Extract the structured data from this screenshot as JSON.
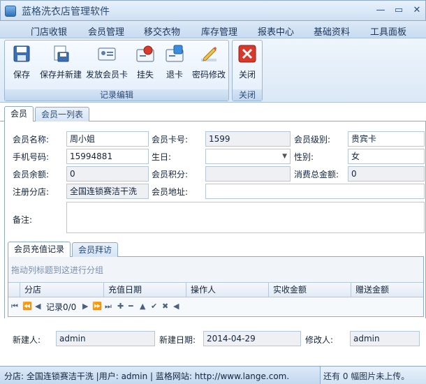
{
  "window": {
    "title": "蓝格洗衣店管理软件"
  },
  "menu": [
    "门店收银",
    "会员管理",
    "移交衣物",
    "库存管理",
    "报表中心",
    "基础资料",
    "工具面板"
  ],
  "ribbon": {
    "groups": [
      {
        "label": "记录编辑",
        "buttons": [
          "保存",
          "保存并新建",
          "发放会员卡",
          "挂失",
          "退卡",
          "密码修改"
        ]
      },
      {
        "label": "关闭",
        "buttons": [
          "关闭"
        ]
      }
    ]
  },
  "tabs": [
    "会员",
    "会员一列表"
  ],
  "form": {
    "name_label": "会员名称:",
    "name_value": "周小姐",
    "card_label": "会员卡号:",
    "card_value": "1599",
    "level_label": "会员级别:",
    "level_value": "贵宾卡",
    "phone_label": "手机号码:",
    "phone_value": "15994881",
    "birthday_label": "生日:",
    "birthday_value": "",
    "gender_label": "性别:",
    "gender_value": "女",
    "balance_label": "会员余额:",
    "balance_value": "0",
    "points_label": "会员积分:",
    "points_value": "",
    "total_label": "消费总金额:",
    "total_value": "0",
    "branch_label": "注册分店:",
    "branch_value": "全国连锁赛洁干洗",
    "address_label": "会员地址:",
    "address_value": "",
    "note_label": "备注:",
    "note_value": ""
  },
  "subtabs": [
    "会员充值记录",
    "会员拜访"
  ],
  "grid": {
    "group_hint": "拖动列标题到这进行分组",
    "columns": [
      "分店",
      "充值日期",
      "操作人",
      "实收金额",
      "赠送金额"
    ],
    "record_text": "记录0/0"
  },
  "footer": {
    "creator_label": "新建人:",
    "creator_value": "admin",
    "created_label": "新建日期:",
    "created_value": "2014-04-29",
    "modifier_label": "修改人:",
    "modifier_value": "admin"
  },
  "status": {
    "left": "分店: 全国连锁赛洁干洗 |用户: admin | 蓝格网站: http://www.lange.com.",
    "right": "还有 0 幅图片未上传。"
  }
}
